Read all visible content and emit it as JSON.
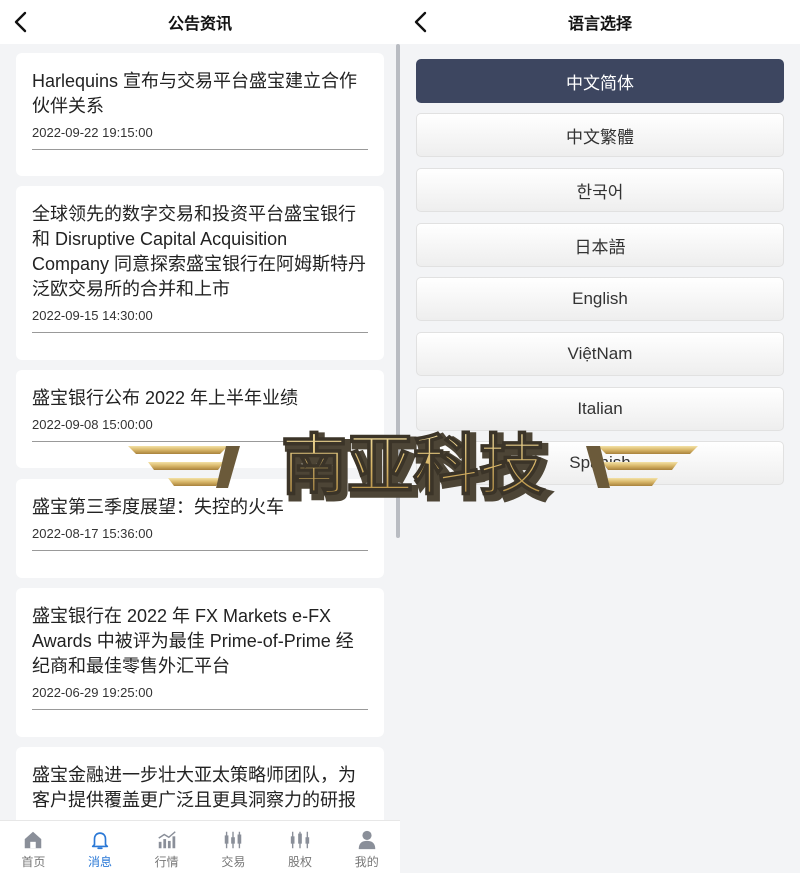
{
  "left": {
    "header": {
      "title": "公告资讯"
    },
    "news": [
      {
        "title": "Harlequins 宣布与交易平台盛宝建立合作伙伴关系",
        "date": "2022-09-22 19:15:00"
      },
      {
        "title": "全球领先的数字交易和投资平台盛宝银行和 Disruptive Capital Acquisition Company 同意探索盛宝银行在阿姆斯特丹泛欧交易所的合并和上市",
        "date": "2022-09-15 14:30:00"
      },
      {
        "title": "盛宝银行公布 2022 年上半年业绩",
        "date": "2022-09-08 15:00:00"
      },
      {
        "title": "盛宝第三季度展望：失控的火车",
        "date": "2022-08-17 15:36:00"
      },
      {
        "title": "盛宝银行在 2022 年 FX Markets e-FX Awards 中被评为最佳 Prime-of-Prime 经纪商和最佳零售外汇平台",
        "date": "2022-06-29 19:25:00"
      },
      {
        "title": "盛宝金融进一步壮大亚太策略师团队，为客户提供覆盖更广泛且更具洞察力的研报",
        "date": ""
      }
    ],
    "tabbar": [
      {
        "label": "首页",
        "icon": "home-icon"
      },
      {
        "label": "消息",
        "icon": "bell-icon",
        "active": true
      },
      {
        "label": "行情",
        "icon": "chart-icon"
      },
      {
        "label": "交易",
        "icon": "candlestick-icon"
      },
      {
        "label": "股权",
        "icon": "equity-icon"
      },
      {
        "label": "我的",
        "icon": "user-icon"
      }
    ]
  },
  "right": {
    "header": {
      "title": "语言选择"
    },
    "languages": [
      {
        "label": "中文简体",
        "selected": true
      },
      {
        "label": "中文繁體"
      },
      {
        "label": "한국어"
      },
      {
        "label": "日本語"
      },
      {
        "label": "English"
      },
      {
        "label": "ViệtNam"
      },
      {
        "label": "Italian"
      },
      {
        "label": "Spanish"
      }
    ]
  },
  "watermark": {
    "text": "南亚科技"
  },
  "colors": {
    "accent": "#3d4660",
    "active_tab": "#2a78d6",
    "background": "#f3f4f6"
  }
}
